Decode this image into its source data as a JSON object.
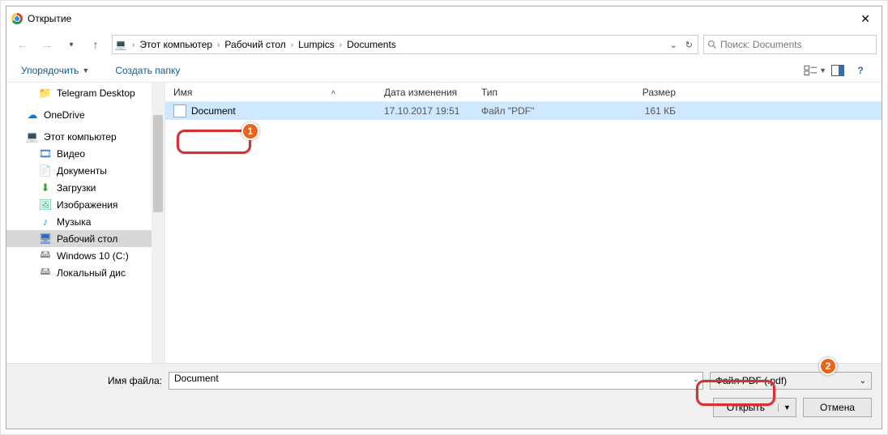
{
  "titlebar": {
    "title": "Открытие"
  },
  "nav": {
    "breadcrumb": [
      "Этот компьютер",
      "Рабочий стол",
      "Lumpics",
      "Documents"
    ],
    "search_placeholder": "Поиск: Documents"
  },
  "toolbar": {
    "organize": "Упорядочить",
    "new_folder": "Создать папку"
  },
  "sidebar": {
    "items": [
      {
        "label": "Telegram Desktop",
        "icon": "folder",
        "level": 2
      },
      {
        "label": "OneDrive",
        "icon": "cloud",
        "level": 1
      },
      {
        "label": "Этот компьютер",
        "icon": "pc",
        "level": 1
      },
      {
        "label": "Видео",
        "icon": "vid",
        "level": 2
      },
      {
        "label": "Документы",
        "icon": "doc",
        "level": 2
      },
      {
        "label": "Загрузки",
        "icon": "dn",
        "level": 2
      },
      {
        "label": "Изображения",
        "icon": "img",
        "level": 2
      },
      {
        "label": "Музыка",
        "icon": "mus",
        "level": 2
      },
      {
        "label": "Рабочий стол",
        "icon": "desk",
        "level": 2,
        "selected": true
      },
      {
        "label": "Windows 10 (C:)",
        "icon": "drv",
        "level": 2
      },
      {
        "label": "Локальный дис",
        "icon": "drv",
        "level": 2
      }
    ]
  },
  "columns": {
    "name": "Имя",
    "date": "Дата изменения",
    "type": "Тип",
    "size": "Размер"
  },
  "files": [
    {
      "name": "Document",
      "date": "17.10.2017 19:51",
      "type": "Файл \"PDF\"",
      "size": "161 КБ",
      "selected": true
    }
  ],
  "bottom": {
    "filename_label": "Имя файла:",
    "filename_value": "Document",
    "filter_label": "Файл PDF (.pdf)",
    "open_label": "Открыть",
    "cancel_label": "Отмена"
  },
  "annotations": {
    "badge1": "1",
    "badge2": "2"
  }
}
